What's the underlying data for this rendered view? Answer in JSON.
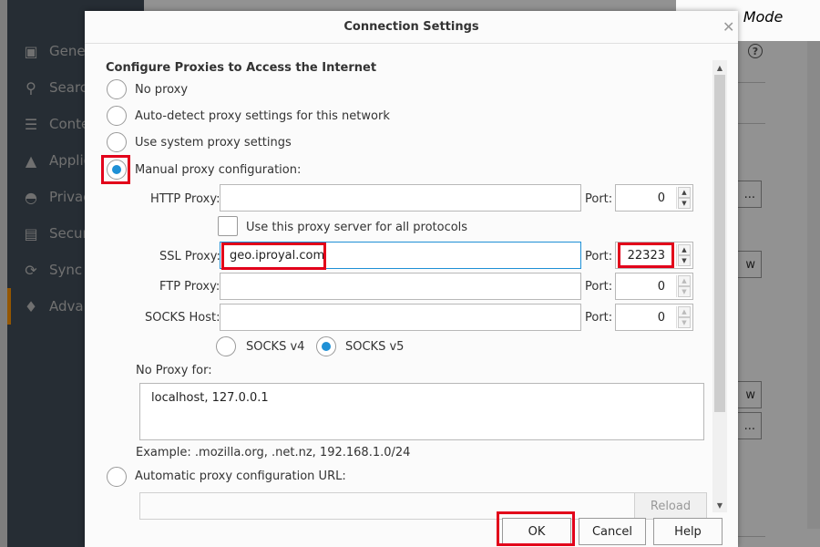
{
  "background": {
    "sidebar": [
      {
        "label": "General",
        "icon": "general-icon"
      },
      {
        "label": "Search",
        "icon": "search-icon"
      },
      {
        "label": "Content",
        "icon": "content-icon"
      },
      {
        "label": "Applications",
        "icon": "applications-icon"
      },
      {
        "label": "Privacy",
        "icon": "privacy-mask-icon"
      },
      {
        "label": "Security",
        "icon": "lock-icon"
      },
      {
        "label": "Sync",
        "icon": "sync-icon"
      },
      {
        "label": "Advanced",
        "icon": "advanced-wizard-icon"
      }
    ],
    "help_glyph": "?",
    "btn_labels": [
      "...",
      "w",
      "w",
      "..."
    ]
  },
  "browse_mode": "Browse Mode",
  "dialog": {
    "title": "Connection Settings",
    "close_glyph": "✕",
    "heading": "Configure Proxies to Access the Internet",
    "options": {
      "no_proxy": "No proxy",
      "auto_detect": "Auto-detect proxy settings for this network",
      "system": "Use system proxy settings",
      "manual": "Manual proxy configuration:",
      "auto_url": "Automatic proxy configuration URL:"
    },
    "selected_option": "manual",
    "http_proxy": {
      "label": "HTTP Proxy:",
      "value": "",
      "port_label": "Port:",
      "port": "0"
    },
    "use_for_all": "Use this proxy server for all protocols",
    "ssl_proxy": {
      "label": "SSL Proxy:",
      "value": "geo.iproyal.com",
      "port_label": "Port:",
      "port": "22323"
    },
    "ftp_proxy": {
      "label": "FTP Proxy:",
      "value": "",
      "port_label": "Port:",
      "port": "0"
    },
    "socks_host": {
      "label": "SOCKS Host:",
      "value": "",
      "port_label": "Port:",
      "port": "0"
    },
    "socks_v4": "SOCKS v4",
    "socks_v5": "SOCKS v5",
    "socks_selected": "v5",
    "no_proxy_for": {
      "label": "No Proxy for:",
      "value": "localhost, 127.0.0.1"
    },
    "example": "Example: .mozilla.org, .net.nz, 192.168.1.0/24",
    "reload": "Reload",
    "buttons": {
      "ok": "OK",
      "cancel": "Cancel",
      "help": "Help"
    }
  },
  "colors": {
    "accent": "#1e90d6",
    "highlight": "#e2001a",
    "sidebar_active": "#ff9500"
  }
}
